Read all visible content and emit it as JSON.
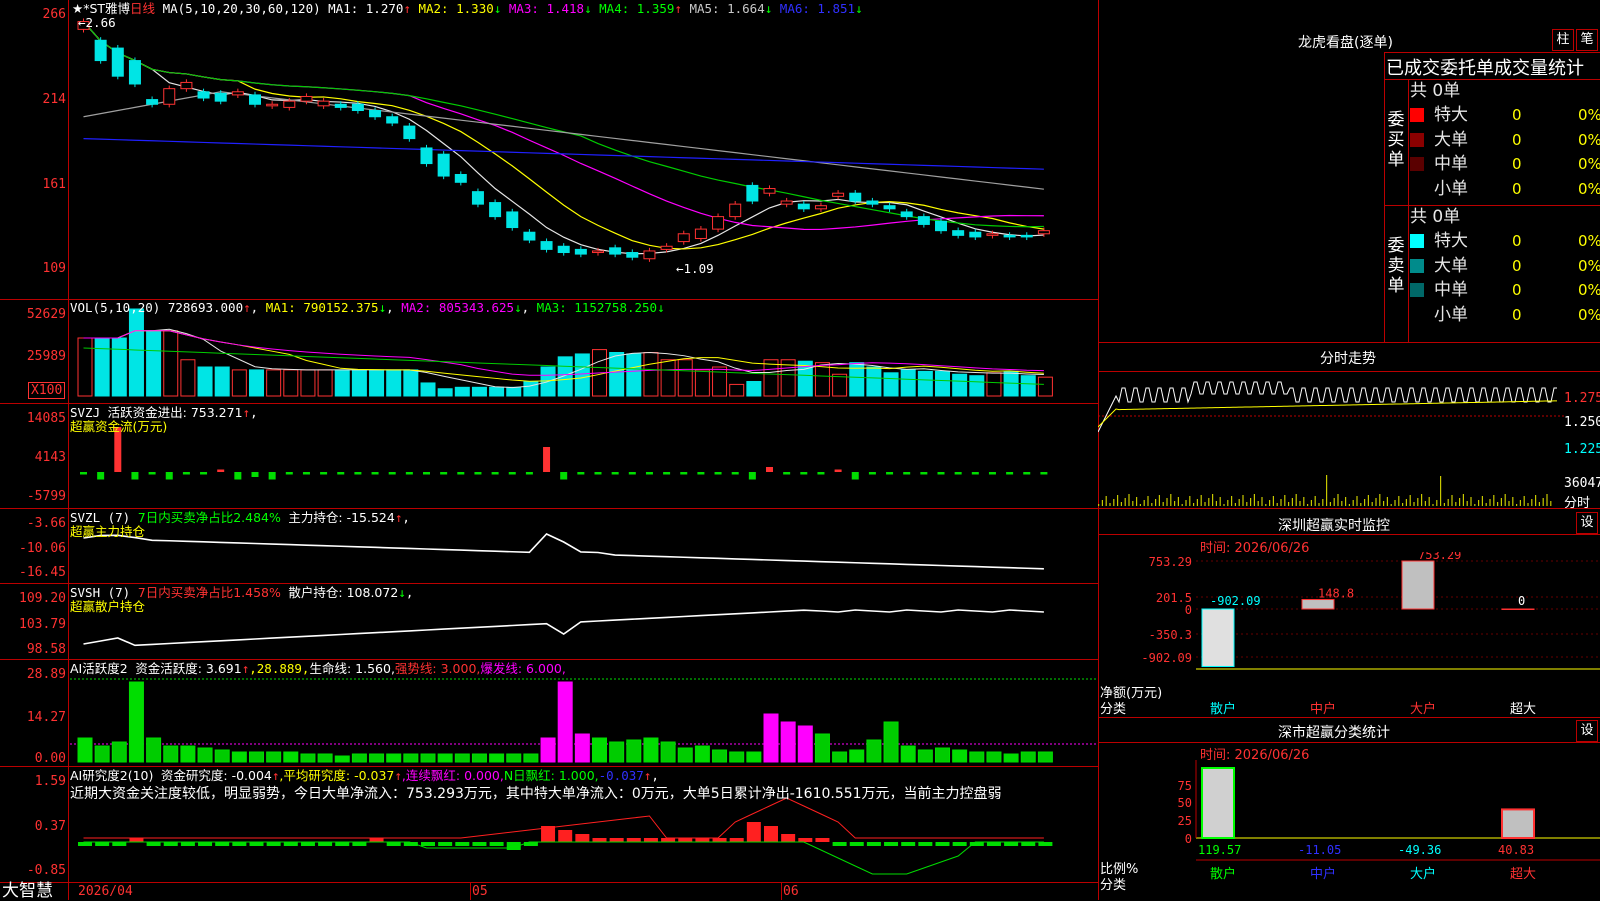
{
  "colors": {
    "up": "#ff3232",
    "down": "#00e5e5",
    "ma1": "#e6e6e6",
    "ma2": "#ffff00",
    "ma3": "#ff00ff",
    "ma4": "#00cc00",
    "ma5": "#a0a0a0",
    "ma6": "#2020ff",
    "grid": "#b00000"
  },
  "kline": {
    "title": "★*ST雅博",
    "period": "日线",
    "ma_label": "MA(5,10,20,30,60,120)",
    "ma1": "MA1: 1.270",
    "ma1_arrow": "↑",
    "ma2": "MA2: 1.330",
    "ma2_arrow": "↓",
    "ma3": "MA3: 1.418",
    "ma3_arrow": "↓",
    "ma4": "MA4: 1.359",
    "ma4_arrow": "↑",
    "ma5": "MA5: 1.664",
    "ma5_arrow": "↓",
    "ma6": "MA6: 1.851",
    "ma6_arrow": "↓",
    "high_label": "←2.66",
    "low_label": "←1.09",
    "yticks": [
      "266",
      "214",
      "161",
      "109"
    ]
  },
  "vol": {
    "label": "VOL(5,10,20)",
    "value": "728693.000",
    "v_arrow": "↑",
    "ma1": "MA1: 790152.375",
    "ma1_arrow": "↓",
    "ma2": "MA2: 805343.625",
    "ma2_arrow": "↓",
    "ma3": "MA3: 1152758.250",
    "ma3_arrow": "↓",
    "yticks": [
      "52629",
      "25989"
    ],
    "unit": "X100"
  },
  "svzj": {
    "label": "SVZJ",
    "desc": "活跃资金进出: 753.271",
    "arrow": "↑",
    "comma": ",",
    "sub": "超赢资金流(万元)",
    "yticks": [
      "14085",
      "4143",
      "-5799"
    ]
  },
  "svzl": {
    "label": "SVZL (7)",
    "desc1": "7日内买卖净占比2.484%",
    "desc2": "主力持仓: -15.524",
    "arrow": "↑",
    "comma": ",",
    "sub": "超赢主力持仓",
    "yticks": [
      "-3.66",
      "-10.06",
      "-16.45"
    ]
  },
  "svsh": {
    "label": "SVSH (7)",
    "desc1": "7日内买卖净占比1.458%",
    "desc2": "散户持仓: 108.072",
    "arrow": "↓",
    "comma": ",",
    "sub": "超赢散户持仓",
    "yticks": [
      "109.20",
      "103.79",
      "98.58"
    ]
  },
  "ai1": {
    "label": "AI活跃度2",
    "desc": "资金活跃度: 3.691",
    "a1": "↑",
    "v2": ",28.889,",
    "v3": "生命线: 1.560,",
    "v4": "强势线: 3.000,",
    "v5": "爆发线: 6.000,",
    "yticks": [
      "28.89",
      "14.27",
      "0.00"
    ]
  },
  "ai2": {
    "label": "AI研究度2(10)",
    "d1": "资金研究度: -0.004",
    "a1": "↑",
    "d2": ",平均研究度: -0.037",
    "a2": "↑",
    "d3": ",连续飘红: 0.000,",
    "d4": "N日飘红: 1.000,",
    "d5": "-0.037",
    "a5": "↑",
    "d6": ",",
    "comment": "近期大资金关注度较低，明显弱势，今日大单净流入：753.293万元，其中特大单净流入：0万元，大单5日累计净出-1610.551万元，当前主力控盘弱",
    "yticks": [
      "1.59",
      "0.37",
      "-0.85"
    ]
  },
  "xaxis": {
    "app": "大智慧",
    "dates": [
      "2026/04",
      "05",
      "06"
    ]
  },
  "right": {
    "tiger_title": "龙虎看盘(逐单)",
    "btn1": "柱",
    "btn2": "笔",
    "tabs": "已成交委托单成交量统计",
    "buy": {
      "vlabel": "委买单",
      "total": "共 0单",
      "rows": [
        {
          "name": "特大",
          "n": "0",
          "p": "0%",
          "color": "#ff0000"
        },
        {
          "name": "大单",
          "n": "0",
          "p": "0%",
          "color": "#8b0000"
        },
        {
          "name": "中单",
          "n": "0",
          "p": "0%",
          "color": "#5a0000"
        },
        {
          "name": "小单",
          "n": "0",
          "p": "0%",
          "color": ""
        }
      ]
    },
    "sell": {
      "vlabel": "委卖单",
      "total": "共 0单",
      "rows": [
        {
          "name": "特大",
          "n": "0",
          "p": "0%",
          "color": "#00ffff"
        },
        {
          "name": "大单",
          "n": "0",
          "p": "0%",
          "color": "#008b8b"
        },
        {
          "name": "中单",
          "n": "0",
          "p": "0%",
          "color": "#006868"
        },
        {
          "name": "小单",
          "n": "0",
          "p": "0%",
          "color": ""
        }
      ]
    },
    "intraday": {
      "title": "分时走势",
      "yticks": [
        "1.275",
        "1.250",
        "1.225"
      ],
      "vol": "36047",
      "vol_unit": "分时"
    },
    "sz_monitor": {
      "title": "深圳超赢实时监控",
      "settings": "设",
      "time": "时间: 2026/06/26",
      "yticks": [
        "753.29",
        "201.5",
        "0",
        "-350.3",
        "-902.09"
      ],
      "yunit": "净额(万元)",
      "xlabel": "分类",
      "categories": [
        "散户",
        "中户",
        "大户",
        "超大"
      ],
      "values": [
        -902.09,
        148.8,
        753.29,
        0
      ],
      "value_labels": [
        "-902.09",
        "148.8",
        "753.29",
        "0"
      ]
    },
    "sz_class": {
      "title": "深市超赢分类统计",
      "settings": "设",
      "time": "时间: 2026/06/26",
      "yticks": [
        "75",
        "50",
        "25",
        "0"
      ],
      "yunit": "比例%",
      "xlabel": "分类",
      "categories": [
        "散户",
        "中户",
        "大户",
        "超大"
      ],
      "values": [
        119.57,
        -11.05,
        -49.36,
        40.83
      ],
      "value_labels": [
        "119.57",
        "-11.05",
        "-49.36",
        "40.83"
      ]
    }
  },
  "chart_data": [
    {
      "type": "candlestick",
      "title": "★*ST雅博 日线",
      "ylim": [
        109,
        266
      ],
      "series_note": "daily OHLC",
      "open": [
        260,
        253,
        248,
        240,
        215,
        212,
        222,
        220,
        219,
        218,
        218,
        211,
        210,
        214,
        211,
        212,
        212,
        208,
        204,
        198,
        184,
        180,
        167,
        156,
        149,
        143,
        130,
        124,
        121,
        119,
        117,
        120,
        117,
        113,
        119,
        124,
        126,
        132,
        140,
        160,
        155,
        148,
        148,
        145,
        153,
        155,
        150,
        147,
        143,
        140,
        137,
        131,
        130,
        128,
        128,
        128,
        129
      ],
      "close": [
        265,
        240,
        230,
        225,
        212,
        222,
        226,
        216,
        214,
        220,
        212,
        212,
        214,
        217,
        214,
        210,
        208,
        204,
        200,
        190,
        174,
        166,
        162,
        148,
        140,
        133,
        125,
        119,
        117,
        116,
        118,
        116,
        114,
        118,
        121,
        129,
        132,
        140,
        148,
        150,
        158,
        150,
        145,
        147,
        155,
        150,
        148,
        145,
        140,
        135,
        131,
        128,
        127,
        129,
        127,
        127,
        131
      ],
      "vol": [
        40,
        40,
        40,
        60,
        45,
        45,
        25,
        20,
        20,
        18,
        18,
        18,
        18,
        18,
        18,
        18,
        18,
        18,
        18,
        18,
        9,
        5,
        6,
        6,
        6,
        6,
        10,
        20,
        27,
        29,
        32,
        30,
        29,
        30,
        25,
        25,
        18,
        20,
        8,
        10,
        25,
        25,
        24,
        23,
        15,
        23,
        20,
        16,
        18,
        17,
        17,
        15,
        14,
        16,
        17,
        14,
        13
      ]
    },
    {
      "type": "bar",
      "title": "深圳超赢实时监控",
      "categories": [
        "散户",
        "中户",
        "大户",
        "超大"
      ],
      "values": [
        -902.09,
        148.8,
        753.29,
        0
      ],
      "ylabel": "净额(万元)"
    },
    {
      "type": "bar",
      "title": "深市超赢分类统计",
      "categories": [
        "散户",
        "中户",
        "大户",
        "超大"
      ],
      "values": [
        119.57,
        -11.05,
        -49.36,
        40.83
      ],
      "ylabel": "比例%"
    }
  ]
}
